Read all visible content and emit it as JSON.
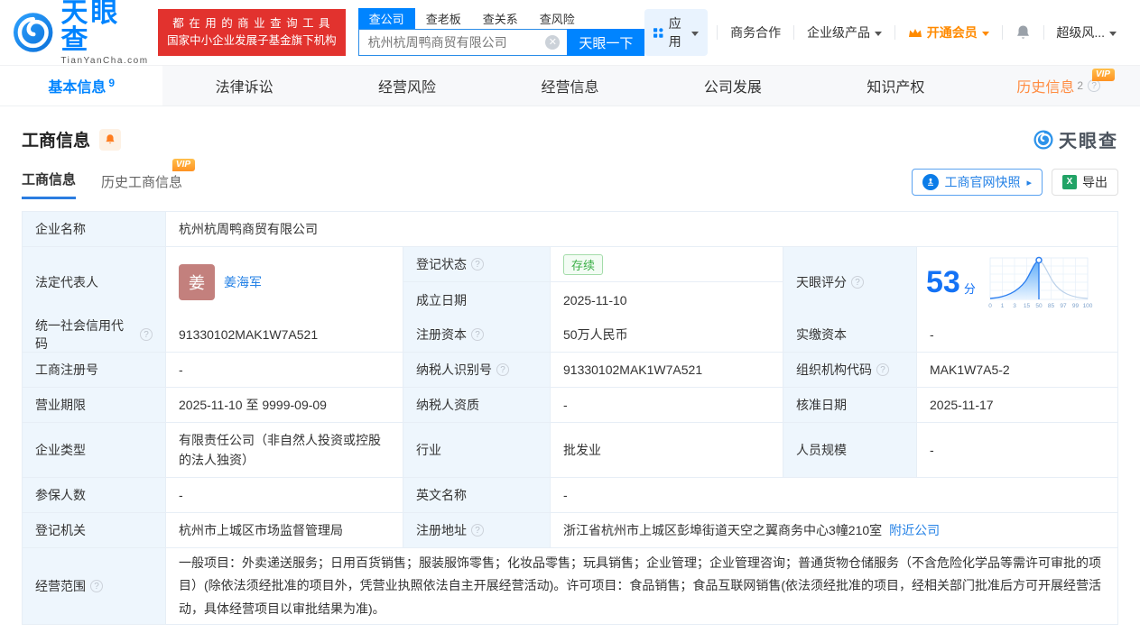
{
  "brand": {
    "name": "天眼查",
    "domain": "TianYanCha.com",
    "slogan_line1": "都 在 用 的 商 业 查 询 工 具",
    "slogan_line2": "国家中小企业发展子基金旗下机构"
  },
  "search": {
    "tabs": [
      "查公司",
      "查老板",
      "查关系",
      "查风险"
    ],
    "active_tab": "查公司",
    "value": "杭州杭周鸭商贸有限公司",
    "button_label": "天眼一下"
  },
  "header_nav": {
    "apps": "应用",
    "biz": "商务合作",
    "enterprise": "企业级产品",
    "vip": "开通会员",
    "risk": "超级风..."
  },
  "page_tabs": {
    "basic": {
      "label": "基本信息",
      "count": "9"
    },
    "legal": {
      "label": "法律诉讼"
    },
    "risk": {
      "label": "经营风险"
    },
    "operation": {
      "label": "经营信息"
    },
    "development": {
      "label": "公司发展"
    },
    "ip": {
      "label": "知识产权"
    },
    "history": {
      "label": "历史信息",
      "count": "2",
      "vip": "VIP"
    }
  },
  "section": {
    "title": "工商信息",
    "subtab_current": "工商信息",
    "subtab_history": "历史工商信息",
    "vip_badge": "VIP",
    "snapshot_button": "工商官网快照",
    "snapshot_arrow": "▸",
    "export_button": "导出",
    "export_icon_text": "X",
    "watermark": "天眼查"
  },
  "table": {
    "company_name": {
      "label": "企业名称",
      "value": "杭州杭周鸭商贸有限公司"
    },
    "legal_rep": {
      "label": "法定代表人",
      "avatar_char": "姜",
      "name": "姜海军"
    },
    "reg_status": {
      "label": "登记状态",
      "value": "存续"
    },
    "establish_date": {
      "label": "成立日期",
      "value": "2025-11-10"
    },
    "score": {
      "label": "天眼评分",
      "value": "53",
      "unit": "分",
      "ticks": [
        "0",
        "1",
        "3",
        "15",
        "50",
        "85",
        "97",
        "99",
        "100"
      ]
    },
    "credit_code": {
      "label": "统一社会信用代码",
      "value": "91330102MAK1W7A521"
    },
    "reg_capital": {
      "label": "注册资本",
      "value": "50万人民币"
    },
    "paid_capital": {
      "label": "实缴资本",
      "value": "-"
    },
    "reg_number": {
      "label": "工商注册号",
      "value": "-"
    },
    "taxpayer_id": {
      "label": "纳税人识别号",
      "value": "91330102MAK1W7A521"
    },
    "org_code": {
      "label": "组织机构代码",
      "value": "MAK1W7A5-2"
    },
    "business_term": {
      "label": "营业期限",
      "value": "2025-11-10 至 9999-09-09"
    },
    "taxpayer_quality": {
      "label": "纳税人资质",
      "value": "-"
    },
    "approval_date": {
      "label": "核准日期",
      "value": "2025-11-17"
    },
    "company_type": {
      "label": "企业类型",
      "value": "有限责任公司（非自然人投资或控股的法人独资）"
    },
    "industry": {
      "label": "行业",
      "value": "批发业"
    },
    "staff_size": {
      "label": "人员规模",
      "value": "-"
    },
    "insured_count": {
      "label": "参保人数",
      "value": "-"
    },
    "english_name": {
      "label": "英文名称",
      "value": "-"
    },
    "reg_authority": {
      "label": "登记机关",
      "value": "杭州市上城区市场监督管理局"
    },
    "reg_address": {
      "label": "注册地址",
      "value": "浙江省杭州市上城区彭埠街道天空之翼商务中心3幢210室",
      "nearby_link": "附近公司"
    },
    "business_scope": {
      "label": "经营范围",
      "value": "一般项目：外卖递送服务；日用百货销售；服装服饰零售；化妆品零售；玩具销售；企业管理；企业管理咨询；普通货物仓储服务（不含危险化学品等需许可审批的项目）(除依法须经批准的项目外，凭营业执照依法自主开展经营活动)。许可项目：食品销售；食品互联网销售(依法须经批准的项目，经相关部门批准后方可开展经营活动，具体经营项目以审批结果为准)。"
    }
  }
}
